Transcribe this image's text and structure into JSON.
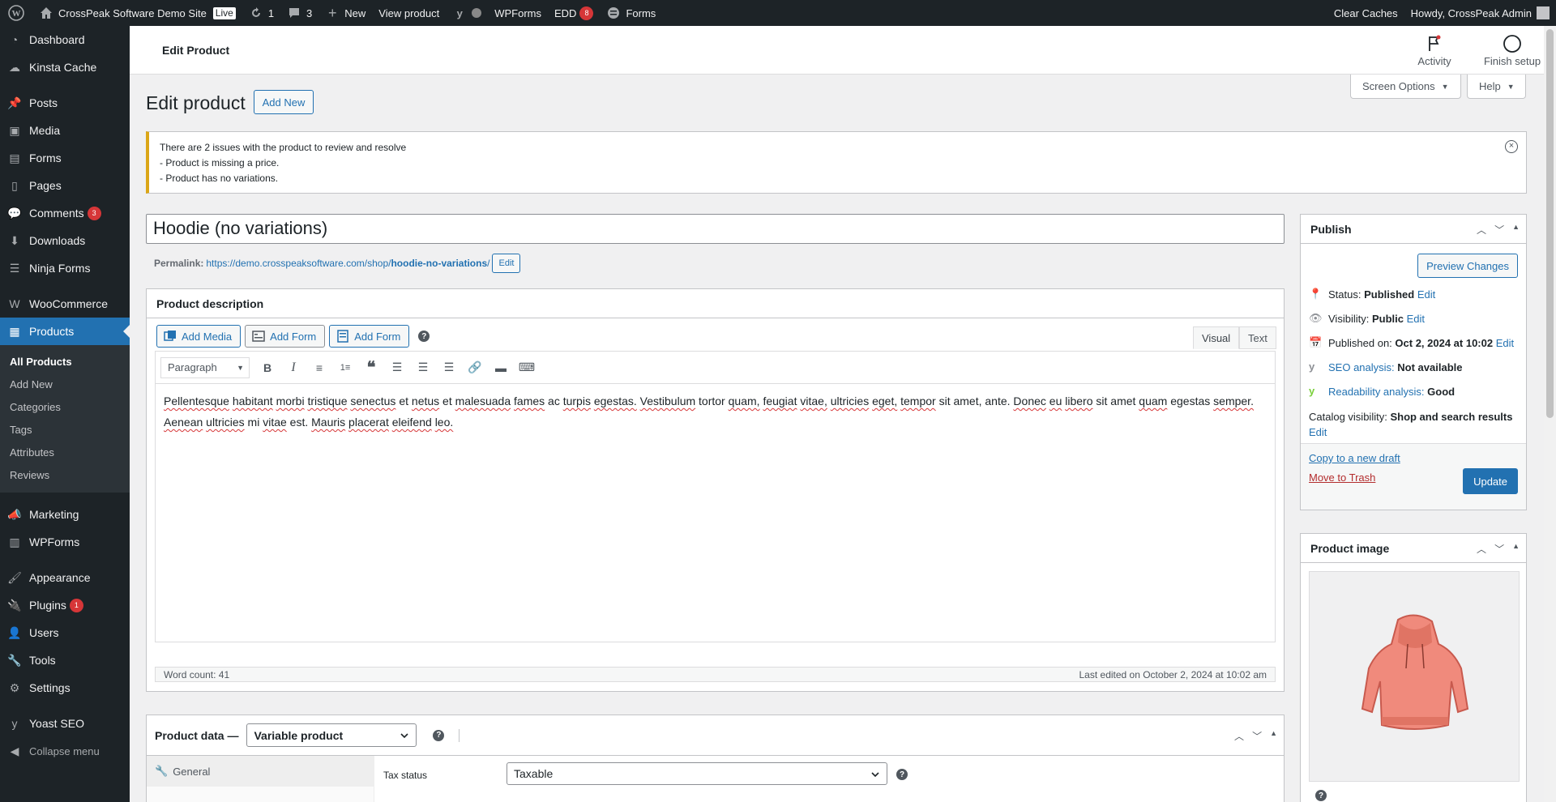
{
  "adminbar": {
    "site_name": "CrossPeak Software Demo Site",
    "live_badge": "Live",
    "updates_count": "1",
    "comments_count": "3",
    "new_label": "New",
    "view_product_label": "View product",
    "wpforms_label": "WPForms",
    "edd_label": "EDD",
    "edd_count": "8",
    "forms_label": "Forms",
    "clear_caches_label": "Clear Caches",
    "howdy_label": "Howdy, CrossPeak Admin"
  },
  "sidebar": {
    "items": [
      {
        "label": "Dashboard",
        "icon": "dashboard-icon"
      },
      {
        "label": "Kinsta Cache",
        "icon": "cloud-icon"
      },
      {
        "label": "Posts",
        "icon": "pin-icon"
      },
      {
        "label": "Media",
        "icon": "media-icon"
      },
      {
        "label": "Forms",
        "icon": "forms-icon"
      },
      {
        "label": "Pages",
        "icon": "pages-icon"
      },
      {
        "label": "Comments",
        "icon": "comments-icon",
        "badge": "3"
      },
      {
        "label": "Downloads",
        "icon": "download-icon"
      },
      {
        "label": "Ninja Forms",
        "icon": "ninja-icon"
      },
      {
        "label": "WooCommerce",
        "icon": "woo-icon"
      },
      {
        "label": "Products",
        "icon": "products-icon"
      },
      {
        "label": "Marketing",
        "icon": "megaphone-icon"
      },
      {
        "label": "WPForms",
        "icon": "wpforms-icon"
      },
      {
        "label": "Appearance",
        "icon": "brush-icon"
      },
      {
        "label": "Plugins",
        "icon": "plugin-icon",
        "badge": "1"
      },
      {
        "label": "Users",
        "icon": "users-icon"
      },
      {
        "label": "Tools",
        "icon": "wrench-icon"
      },
      {
        "label": "Settings",
        "icon": "settings-icon"
      },
      {
        "label": "Yoast SEO",
        "icon": "yoast-icon"
      },
      {
        "label": "Collapse menu",
        "icon": "collapse-icon"
      }
    ],
    "submenu": [
      "All Products",
      "Add New",
      "Categories",
      "Tags",
      "Attributes",
      "Reviews"
    ]
  },
  "wc_header": {
    "title": "Edit Product",
    "activity_label": "Activity",
    "finish_setup_label": "Finish setup"
  },
  "screen_options_label": "Screen Options",
  "help_label": "Help",
  "page": {
    "heading": "Edit product",
    "add_new_label": "Add New"
  },
  "notice": {
    "line1": "There are 2 issues with the product to review and resolve",
    "line2": "- Product is missing a price.",
    "line3": "- Product has no variations."
  },
  "product": {
    "title": "Hoodie (no variations)",
    "permalink_label": "Permalink:",
    "permalink_base": "https://demo.crosspeaksoftware.com/shop/",
    "permalink_slug": "hoodie-no-variations",
    "permalink_trailing": "/",
    "permalink_edit": "Edit"
  },
  "description_box": {
    "title": "Product description",
    "add_media": "Add Media",
    "add_form_1": "Add Form",
    "add_form_2": "Add Form",
    "tab_visual": "Visual",
    "tab_text": "Text",
    "format_select": "Paragraph",
    "content_words": [
      "Pellentesque",
      "habitant",
      "morbi",
      "tristique",
      "senectus",
      "et",
      "netus",
      "et",
      "malesuada",
      "fames",
      "ac",
      "turpis",
      "egestas.",
      "Vestibulum",
      "tortor",
      "quam,",
      "feugiat",
      "vitae,",
      "ultricies",
      "eget,",
      "tempor",
      "sit",
      "amet,",
      "ante.",
      "Donec",
      "eu",
      "libero",
      "sit",
      "amet",
      "quam",
      "egestas",
      "semper.",
      "Aenean",
      "ultricies",
      "mi",
      "vitae",
      "est.",
      "Mauris",
      "placerat",
      "eleifend",
      "leo."
    ],
    "word_count": "Word count: 41",
    "last_edited": "Last edited on October 2, 2024 at 10:02 am"
  },
  "publish": {
    "title": "Publish",
    "preview_label": "Preview Changes",
    "status_label": "Status:",
    "status_value": "Published",
    "visibility_label": "Visibility:",
    "visibility_value": "Public",
    "published_label": "Published on:",
    "published_value": "Oct 2, 2024 at 10:02",
    "edit_label": "Edit",
    "seo_label": "SEO analysis:",
    "seo_value": "Not available",
    "readability_label": "Readability analysis:",
    "readability_value": "Good",
    "catalog_label": "Catalog visibility:",
    "catalog_value": "Shop and search results",
    "copy_draft": "Copy to a new draft",
    "trash": "Move to Trash",
    "update_label": "Update"
  },
  "product_image": {
    "title": "Product image",
    "image_alt": "hoodie-image"
  },
  "product_data": {
    "title": "Product data —",
    "type_value": "Variable product",
    "tab_general": "General",
    "tax_status_label": "Tax status",
    "tax_status_value": "Taxable"
  },
  "colors": {
    "accent": "#2271b1",
    "adminbar": "#1d2327",
    "warning": "#dba617",
    "badge": "#d63638"
  }
}
